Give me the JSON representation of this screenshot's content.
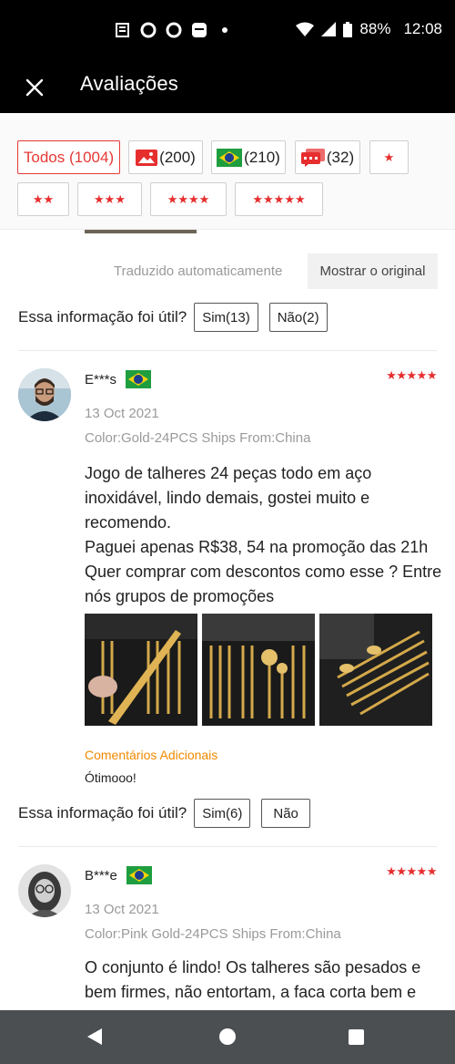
{
  "status_bar": {
    "battery": "88%",
    "time": "12:08"
  },
  "app_bar": {
    "title": "Avaliações",
    "close_icon": "close-icon"
  },
  "filters": {
    "all": "Todos (1004)",
    "photos": "(200)",
    "brazil": "(210)",
    "comments": "(32)",
    "one_star": "★",
    "two_stars": "★★",
    "three_stars": "★★★",
    "four_stars": "★★★★",
    "five_stars": "★★★★★",
    "accent_color": "#e53935"
  },
  "previous_review": {
    "translated_label": "Traduzido automaticamente",
    "show_original": "Mostrar o original",
    "useful_question": "Essa informação foi útil?",
    "yes": "Sim(13)",
    "no": "Não(2)"
  },
  "reviews": [
    {
      "name": "E***s",
      "stars": "★★★★★",
      "date": "13 Oct 2021",
      "meta": "Color:Gold-24PCS Ships From:China",
      "text": "Jogo de talheres 24 peças todo em aço\ninoxidável, lindo demais, gostei muito e\nrecomendo.\nPaguei apenas R$38, 54 na promoção das 21h\nQuer comprar com descontos como esse ? Entre\nnós grupos de promoções",
      "extra_label": "Comentários Adicionais",
      "extra_text": "Ótimooo!",
      "useful_question": "Essa informação foi útil?",
      "yes": "Sim(6)",
      "no": "Não"
    },
    {
      "name": "B***e",
      "stars": "★★★★★",
      "date": "13 Oct 2021",
      "meta": "Color:Pink Gold-24PCS Ships From:China",
      "text": "O conjunto é lindo! Os talheres são pesados e\nbem firmes, não entortam, a faca corta bem e"
    }
  ]
}
